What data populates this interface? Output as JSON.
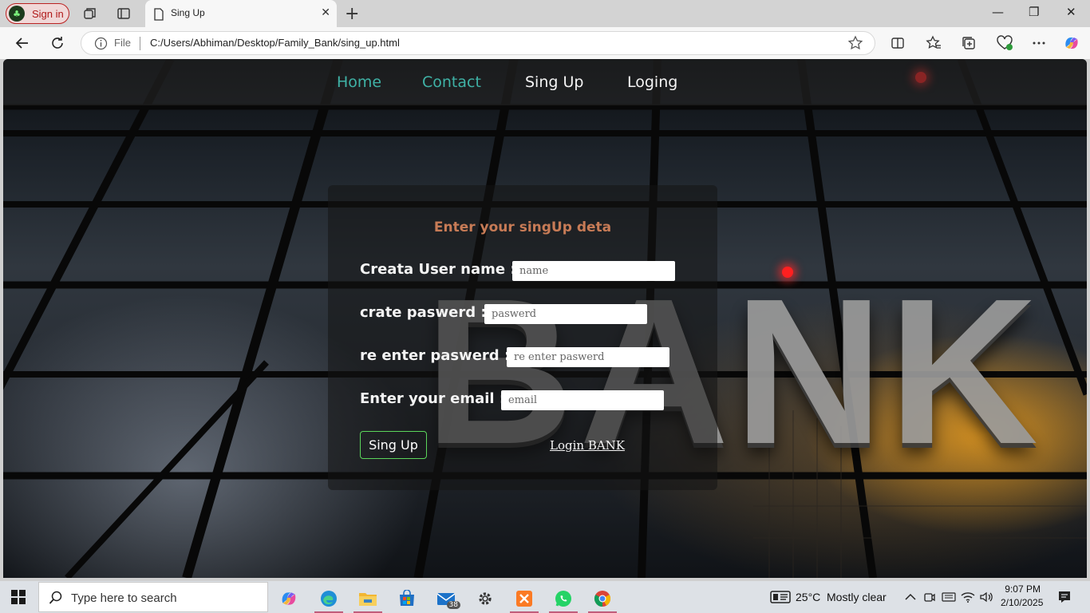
{
  "browser": {
    "signin_label": "Sign in",
    "tab_title": "Sing Up",
    "address_prefix": "File",
    "address_url": "C:/Users/Abhiman/Desktop/Family_Bank/sing_up.html"
  },
  "page": {
    "nav": [
      {
        "label": "Home",
        "color": "#3fb2a6"
      },
      {
        "label": "Contact",
        "color": "#3fb2a6"
      },
      {
        "label": "Sing Up",
        "color": "#f4f4f4"
      },
      {
        "label": "Loging",
        "color": "#f4f4f4"
      }
    ],
    "background_sign": "BANK",
    "form": {
      "title": "Enter your singUp deta",
      "fields": [
        {
          "label": "Creata User name :",
          "placeholder": "name"
        },
        {
          "label": "crate paswerd :",
          "placeholder": "paswerd"
        },
        {
          "label": "re enter paswerd :",
          "placeholder": "re enter paswerd"
        },
        {
          "label": "Enter your email :",
          "placeholder": "email"
        }
      ],
      "submit_label": "Sing Up",
      "login_link": "Login BANK"
    }
  },
  "taskbar": {
    "search_placeholder": "Type here to search",
    "mail_badge": "38",
    "weather_temp": "25°C",
    "weather_desc": "Mostly clear",
    "time": "9:07 PM",
    "date": "2/10/2025"
  }
}
